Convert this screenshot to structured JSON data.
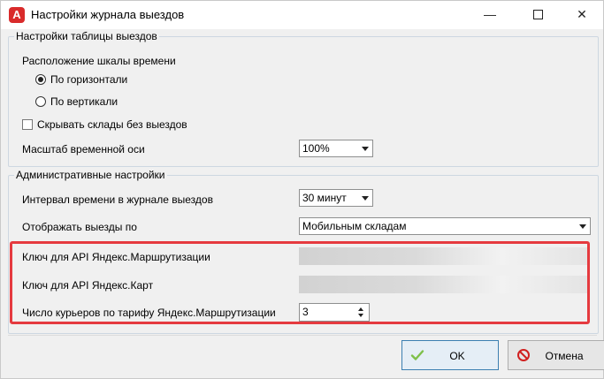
{
  "window": {
    "app_icon": "A",
    "title": "Настройки журнала выездов",
    "minimize_glyph": "—",
    "close_glyph": "✕"
  },
  "group_table": {
    "title": "Настройки таблицы выездов",
    "timeline_label": "Расположение шкалы времени",
    "radio_horizontal": "По горизонтали",
    "radio_vertical": "По вертикали",
    "radio_selected": "horizontal",
    "hide_warehouses_label": "Скрывать склады без выездов",
    "hide_warehouses_checked": false,
    "scale_label": "Масштаб временной оси",
    "scale_value": "100%"
  },
  "group_admin": {
    "title": "Административные настройки",
    "interval_label": "Интервал времени в журнале выездов",
    "interval_value": "30 минут",
    "display_label": "Отображать выезды по",
    "display_value": "Мобильным складам",
    "routing_key_label": "Ключ для API Яндекс.Маршрутизации",
    "maps_key_label": "Ключ для API Яндекс.Карт",
    "couriers_label": "Число курьеров по тарифу Яндекс.Маршрутизации",
    "couriers_value": "3"
  },
  "buttons": {
    "ok": "OK",
    "cancel": "Отмена"
  },
  "colors": {
    "highlight": "#e53a3f",
    "ok_icon": "#7ec04a",
    "cancel_icon": "#d0201f"
  }
}
